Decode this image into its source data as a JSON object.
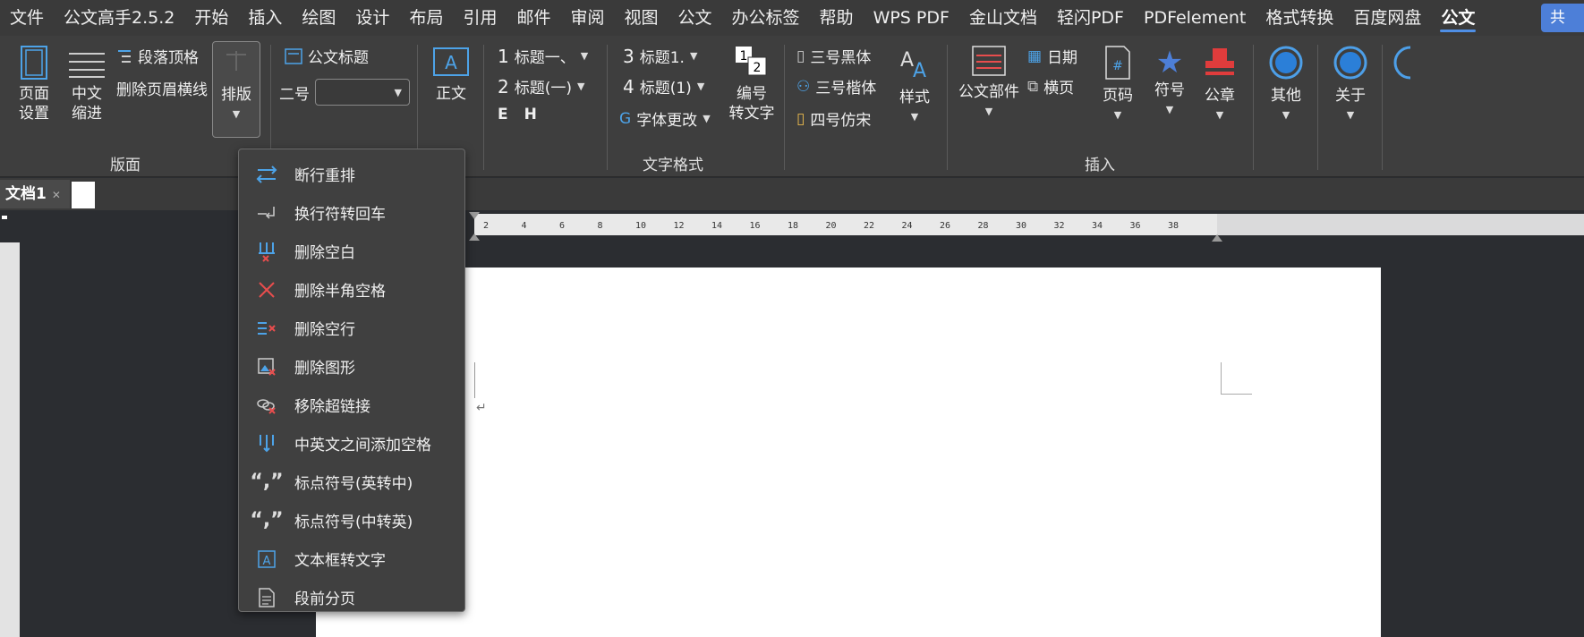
{
  "menubar": {
    "items": [
      "文件",
      "公文高手2.5.2",
      "开始",
      "插入",
      "绘图",
      "设计",
      "布局",
      "引用",
      "邮件",
      "审阅",
      "视图",
      "公文",
      "办公标签",
      "帮助",
      "WPS PDF",
      "金山文档",
      "轻闪PDF",
      "PDFelement",
      "格式转换",
      "百度网盘",
      "公文"
    ],
    "active_index": 20,
    "share_label": "共"
  },
  "ribbon": {
    "layout_group": {
      "label": "版面",
      "page_setup": "页面\n设置",
      "cn_indent": "中文\n缩进",
      "para_top": "段落顶格",
      "del_header_line": "删除页眉横线",
      "typeset": "排版"
    },
    "text_group": {
      "label": "文字格式",
      "doc_title": "公文标题",
      "size_label": "二号",
      "size_value": "",
      "body": "正文",
      "h1": "标题一、",
      "h2": "标题(一)",
      "h3": "标题1.",
      "h4": "标题(1)",
      "h1_num": "1",
      "h2_num": "2",
      "h3_num": "3",
      "h4_num": "4",
      "e_btn": "E",
      "h_btn": "H",
      "font_change": "字体更改",
      "num_to_text": "编号\n转文字",
      "font_hei": "三号黑体",
      "font_kai": "三号楷体",
      "font_fang": "四号仿宋",
      "style": "样式"
    },
    "insert_group": {
      "label": "插入",
      "parts": "公文部件",
      "date": "日期",
      "landscape": "横页",
      "page_num": "页码",
      "symbol": "符号",
      "seal": "公章"
    },
    "other": "其他",
    "about": "关于"
  },
  "tabs": {
    "doc_name": "文档1"
  },
  "ruler": {
    "ticks": [
      "2",
      "4",
      "6",
      "8",
      "10",
      "12",
      "14",
      "16",
      "18",
      "20",
      "22",
      "24",
      "26",
      "28",
      "30",
      "32",
      "34",
      "36",
      "38"
    ]
  },
  "dropdown": {
    "items": [
      {
        "label": "断行重排",
        "icon": "rearrange-icon"
      },
      {
        "label": "换行符转回车",
        "icon": "linebreak-icon"
      },
      {
        "label": "删除空白",
        "icon": "delete-blank-icon"
      },
      {
        "label": "删除半角空格",
        "icon": "delete-space-icon"
      },
      {
        "label": "删除空行",
        "icon": "delete-empty-line-icon"
      },
      {
        "label": "删除图形",
        "icon": "delete-image-icon"
      },
      {
        "label": "移除超链接",
        "icon": "remove-link-icon"
      },
      {
        "label": "中英文之间添加空格",
        "icon": "add-space-icon"
      },
      {
        "label": "标点符号(英转中)",
        "icon": "punct-en-cn-icon"
      },
      {
        "label": "标点符号(中转英)",
        "icon": "punct-cn-en-icon"
      },
      {
        "label": "文本框转文字",
        "icon": "textbox-to-text-icon"
      },
      {
        "label": "段前分页",
        "icon": "page-break-icon"
      }
    ]
  }
}
